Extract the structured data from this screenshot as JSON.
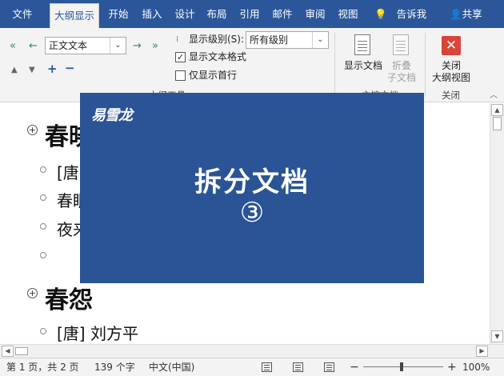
{
  "tabs": [
    "文件",
    "大纲显示",
    "开始",
    "插入",
    "设计",
    "布局",
    "引用",
    "邮件",
    "审阅",
    "视图"
  ],
  "tell_me": "告诉我",
  "share": "共享",
  "ribbon": {
    "outline_level": "正文文本",
    "show_level_label": "显示级别(S):",
    "show_level_value": "所有级别",
    "show_text_format": "显示文本格式",
    "show_first_line_only": "仅显示首行",
    "show_document_label": "显示文档",
    "collapse_subdocuments_label_1": "折叠",
    "collapse_subdocuments_label_2": "子文档",
    "close_outline_label_1": "关闭",
    "close_outline_label_2": "大纲视图",
    "close_group_label": "关闭",
    "group_label_partial_1": "大纲工具",
    "group_label_partial_2": "主控文档"
  },
  "document": {
    "heading1": "春晓",
    "item1": "[唐]",
    "item2": "春眠",
    "item3": "夜来",
    "heading2": "春怨",
    "item5": "[唐]  刘方平"
  },
  "overlay": {
    "logo": "易雪龙",
    "title": "拆分文档",
    "number": "③"
  },
  "status": {
    "page": "第 1 页，共 2 页",
    "words": "139 个字",
    "language": "中文(中国)",
    "zoom": "100%",
    "zoom_minus": "−",
    "zoom_plus": "+"
  },
  "colors": {
    "accent": "#2b579a",
    "overlay": "#2a5496",
    "close_red": "#d9453a"
  }
}
